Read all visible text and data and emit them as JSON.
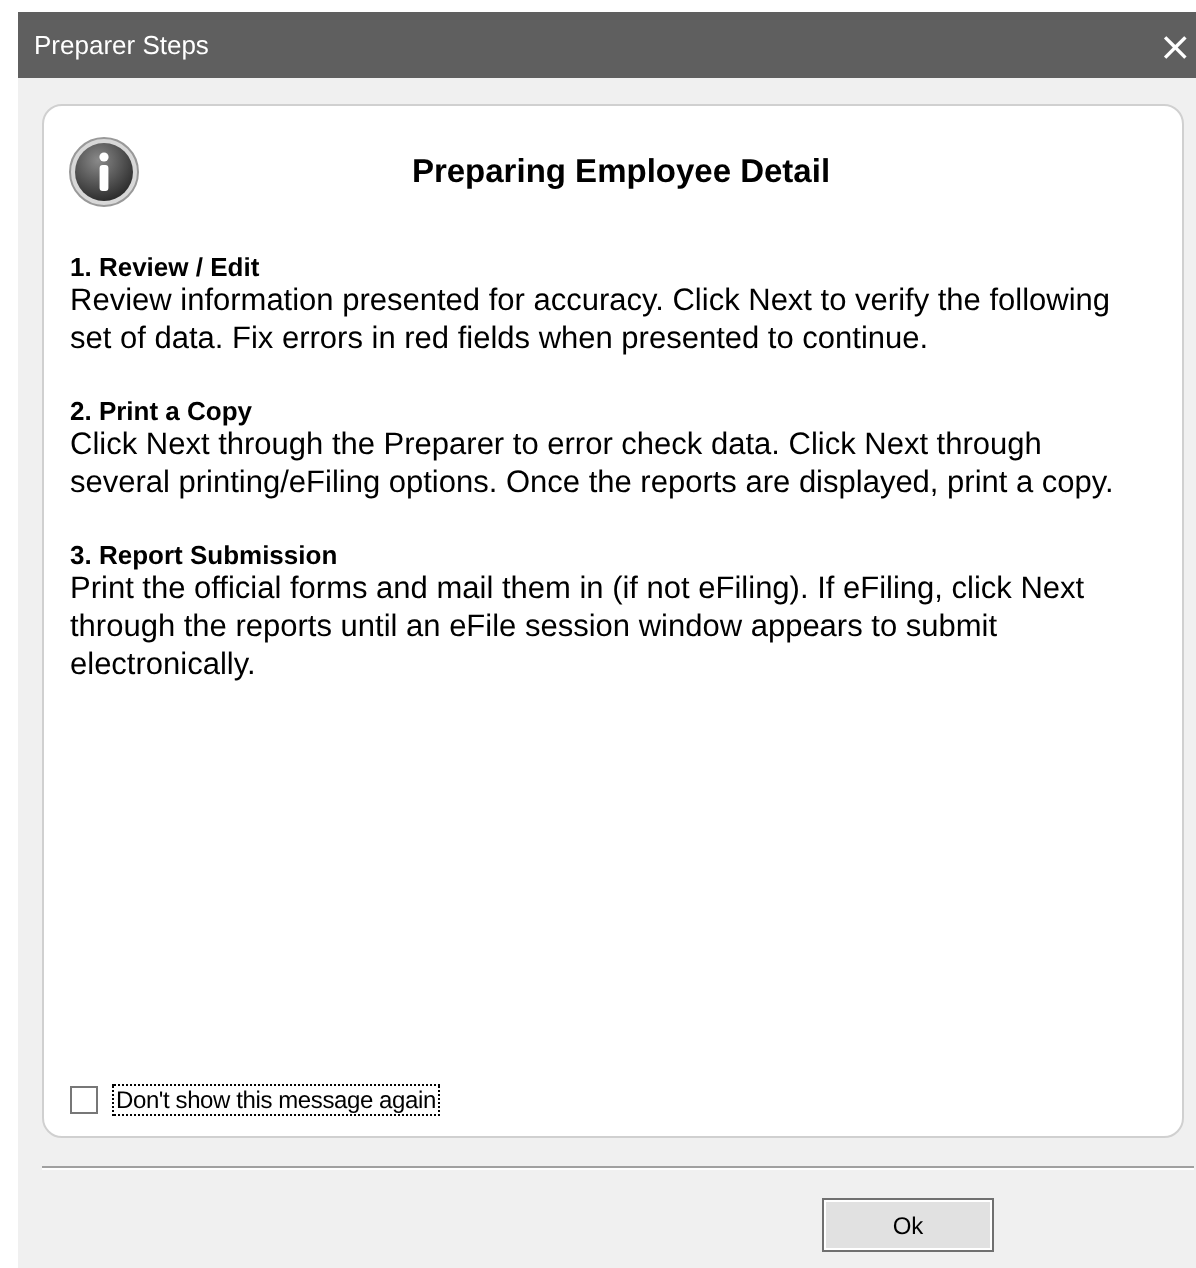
{
  "window": {
    "title": "Preparer Steps",
    "close": "×"
  },
  "heading": "Preparing Employee Detail",
  "steps": [
    {
      "title": "1. Review / Edit",
      "text": "Review information presented for accuracy. Click Next to verify the following set of data. Fix errors in red fields when presented to continue."
    },
    {
      "title": "2. Print a Copy",
      "text": "Click Next through the Preparer to error check data. Click Next through several printing/eFiling options. Once the reports are displayed, print a copy."
    },
    {
      "title": "3. Report Submission",
      "text": "Print the official forms and mail them in (if not eFiling). If eFiling, click Next through the reports until an eFile session window appears to submit electronically."
    }
  ],
  "dont_show": {
    "label": "Don't show this message again",
    "checked": false
  },
  "buttons": [
    "Ok"
  ]
}
